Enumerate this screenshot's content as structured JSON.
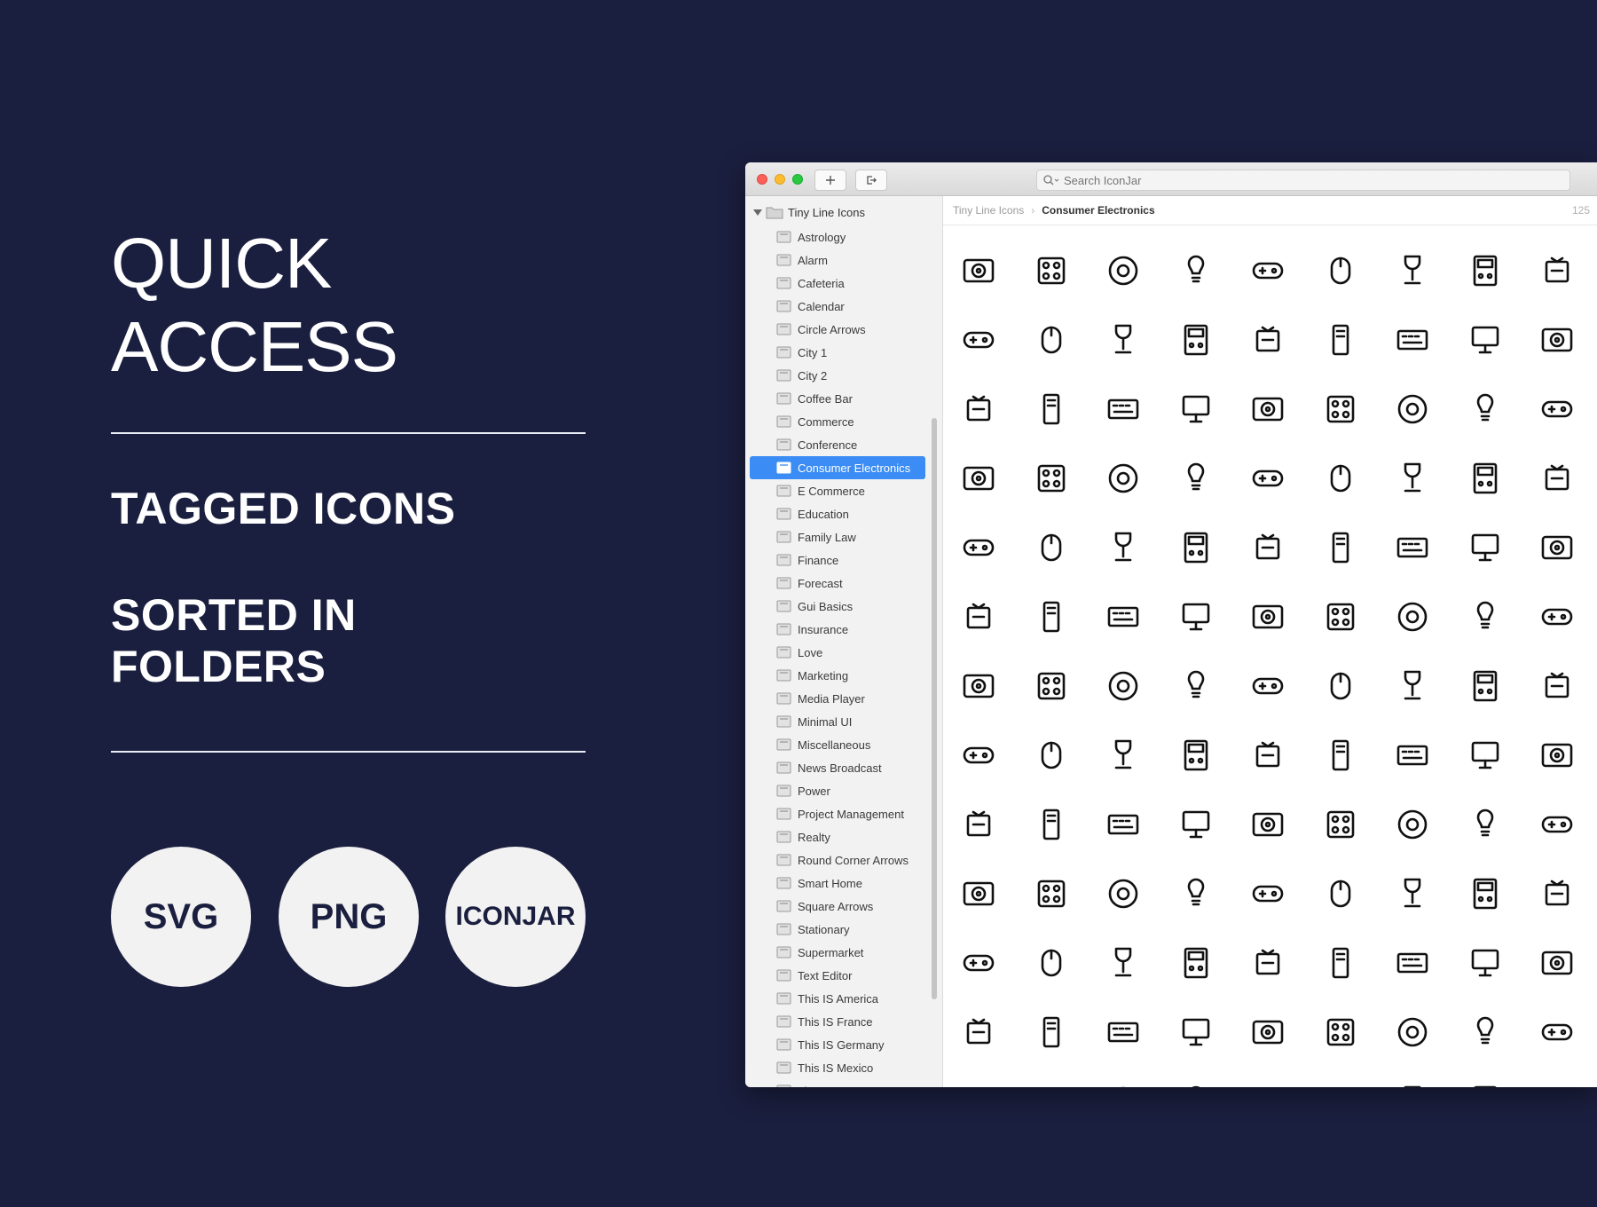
{
  "promo": {
    "headline_line1": "QUICK",
    "headline_line2": "ACCESS",
    "tag1": "TAGGED ICONS",
    "tag2_line1": "SORTED IN",
    "tag2_line2": "FOLDERS",
    "badges": [
      "SVG",
      "PNG",
      "ICONJAR"
    ]
  },
  "window": {
    "toolbar": {
      "add_icon": "plus-icon",
      "export_icon": "export-icon"
    },
    "search": {
      "placeholder": "Search IconJar"
    },
    "sidebar": {
      "root_label": "Tiny Line Icons",
      "items": [
        "Astrology",
        "Alarm",
        "Cafeteria",
        "Calendar",
        "Circle Arrows",
        "City 1",
        "City 2",
        "Coffee Bar",
        "Commerce",
        "Conference",
        "Consumer Electronics",
        "E Commerce",
        "Education",
        "Family Law",
        "Finance",
        "Forecast",
        "Gui Basics",
        "Insurance",
        "Love",
        "Marketing",
        "Media Player",
        "Minimal UI",
        "Miscellaneous",
        "News Broadcast",
        "Power",
        "Project Management",
        "Realty",
        "Round Corner Arrows",
        "Smart Home",
        "Square Arrows",
        "Stationary",
        "Supermarket",
        "Text Editor",
        "This IS America",
        "This IS France",
        "This IS Germany",
        "This IS Mexico",
        "Time"
      ],
      "selected": "Consumer Electronics"
    },
    "breadcrumb": {
      "root": "Tiny Line Icons",
      "current": "Consumer Electronics",
      "count": "125"
    },
    "icon_grid": {
      "columns": 9,
      "visible_count": 117
    }
  }
}
